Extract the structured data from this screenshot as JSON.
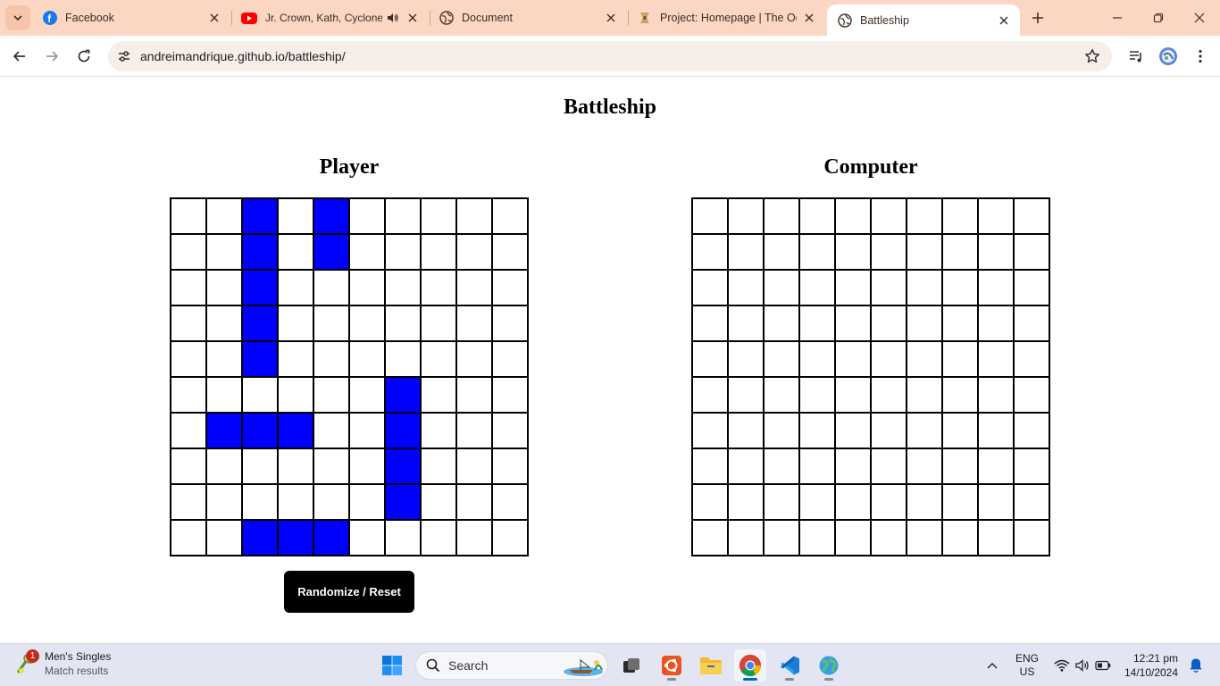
{
  "browser": {
    "tabs": [
      {
        "title": "Facebook",
        "icon": "facebook-icon",
        "active": false
      },
      {
        "title": "Jr. Crown, Kath, Cyclone,",
        "icon": "youtube-icon",
        "audio": true,
        "active": false
      },
      {
        "title": "Document",
        "icon": "globe-icon",
        "active": false
      },
      {
        "title": "Project: Homepage | The Od",
        "icon": "odin-icon",
        "active": false
      },
      {
        "title": "Battleship",
        "icon": "globe-icon",
        "active": true
      }
    ],
    "url": "andreimandrique.github.io/battleship/",
    "colors": {
      "tabstrip": "#fbd7c3",
      "active_tab": "#ffffff",
      "omnibox": "#f5eee9"
    }
  },
  "page": {
    "title": "Battleship",
    "player_title": "Player",
    "computer_title": "Computer",
    "reset_label": "Randomize / Reset",
    "colors": {
      "ship": "#0000ff",
      "grid_line": "#000000",
      "button_bg": "#000000"
    }
  },
  "boards": {
    "size": 10,
    "player_ships": [
      [
        0,
        2
      ],
      [
        1,
        2
      ],
      [
        2,
        2
      ],
      [
        3,
        2
      ],
      [
        4,
        2
      ],
      [
        0,
        4
      ],
      [
        1,
        4
      ],
      [
        5,
        6
      ],
      [
        6,
        6
      ],
      [
        7,
        6
      ],
      [
        8,
        6
      ],
      [
        6,
        1
      ],
      [
        6,
        2
      ],
      [
        6,
        3
      ],
      [
        9,
        2
      ],
      [
        9,
        3
      ],
      [
        9,
        4
      ]
    ],
    "computer_ships": []
  },
  "taskbar": {
    "widget_title": "Men's Singles",
    "widget_subtitle": "Match results",
    "widget_badge": "1",
    "search_placeholder": "Search",
    "lang_line1": "ENG",
    "lang_line2": "US",
    "time": "12:21 pm",
    "date": "14/10/2024"
  }
}
